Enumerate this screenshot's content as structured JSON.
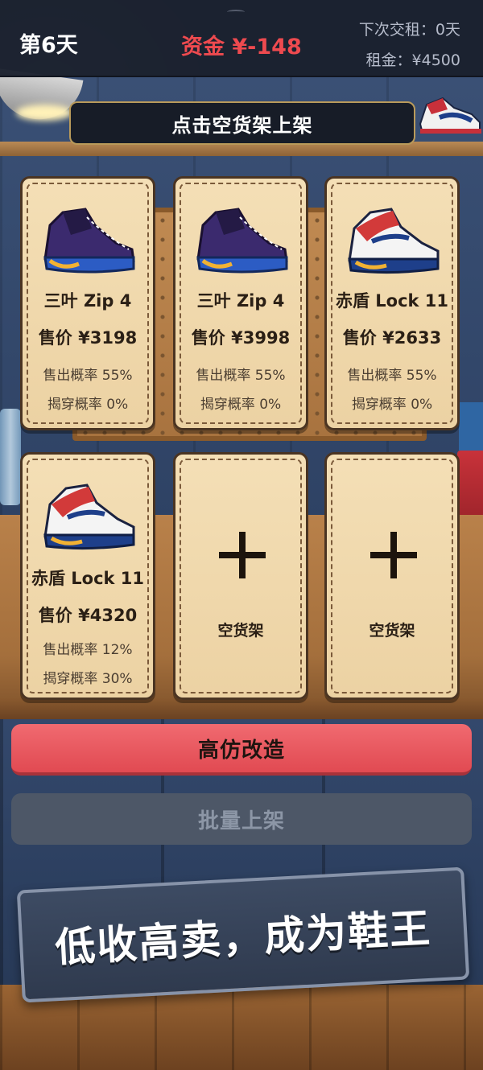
{
  "header": {
    "day": "第6天",
    "funds": "资金 ¥-148",
    "next_rent": "下次交租：0天",
    "rent": "租金：¥4500"
  },
  "hint": "点击空货架上架",
  "shelves": [
    {
      "name": "三叶 Zip 4",
      "price": "售价 ¥3198",
      "sell_rate": "售出概率 55%",
      "expose_rate": "揭穿概率 0%",
      "shoe_icon": "purple-blue-sneaker-icon"
    },
    {
      "name": "三叶 Zip 4",
      "price": "售价 ¥3998",
      "sell_rate": "售出概率 55%",
      "expose_rate": "揭穿概率 0%",
      "shoe_icon": "purple-blue-sneaker-icon"
    },
    {
      "name": "赤盾 Lock 11",
      "price": "售价 ¥2633",
      "sell_rate": "售出概率 55%",
      "expose_rate": "揭穿概率 0%",
      "shoe_icon": "white-red-sneaker-icon"
    },
    {
      "name": "赤盾 Lock 11",
      "price": "售价 ¥4320",
      "sell_rate": "售出概率 12%",
      "expose_rate": "揭穿概率 30%",
      "shoe_icon": "white-red-sneaker-icon"
    },
    {
      "empty_label": "空货架",
      "icon": "plus-icon"
    },
    {
      "empty_label": "空货架",
      "icon": "plus-icon"
    }
  ],
  "actions": {
    "modify_label": "高仿改造",
    "bulk_label": "批量上架"
  },
  "slogan": "低收高卖，成为鞋王",
  "colors": {
    "funds_negative": "#ee4a4f",
    "primary_button": "#e14a52",
    "disabled_button": "#4d5767",
    "card_bg": "#f4dfb6"
  }
}
